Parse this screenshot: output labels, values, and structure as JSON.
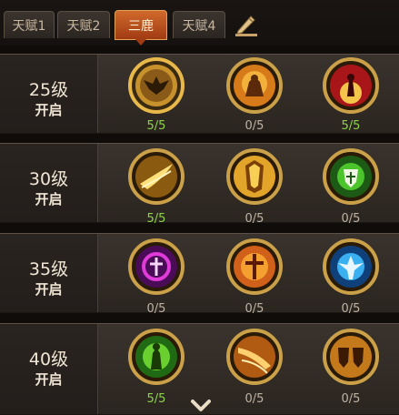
{
  "tabs": [
    {
      "label": "天赋1",
      "active": false
    },
    {
      "label": "天赋2",
      "active": false
    },
    {
      "label": "三鹿",
      "active": true
    },
    {
      "label": "天赋4",
      "active": false
    }
  ],
  "rows": [
    {
      "level": "25级",
      "state": "开启",
      "skills": [
        {
          "name": "winged-emblem-icon",
          "count": "5/5",
          "maxed": true,
          "selected": true
        },
        {
          "name": "warrior-flame-icon",
          "count": "0/5",
          "maxed": false
        },
        {
          "name": "red-figure-icon",
          "count": "5/5",
          "maxed": true
        }
      ]
    },
    {
      "level": "30级",
      "state": "开启",
      "skills": [
        {
          "name": "golden-slash-icon",
          "count": "5/5",
          "maxed": true
        },
        {
          "name": "golden-armor-icon",
          "count": "0/5",
          "maxed": false
        },
        {
          "name": "green-shield-icon",
          "count": "0/5",
          "maxed": false
        }
      ]
    },
    {
      "level": "35级",
      "state": "开启",
      "skills": [
        {
          "name": "purple-cross-icon",
          "count": "0/5",
          "maxed": false
        },
        {
          "name": "fire-cross-icon",
          "count": "0/5",
          "maxed": false
        },
        {
          "name": "blue-angel-icon",
          "count": "0/5",
          "maxed": false
        }
      ]
    },
    {
      "level": "40级",
      "state": "开启",
      "skills": [
        {
          "name": "green-monk-icon",
          "count": "5/5",
          "maxed": true
        },
        {
          "name": "orange-strike-icon",
          "count": "0/5",
          "maxed": false
        },
        {
          "name": "twin-shield-icon",
          "count": "0/5",
          "maxed": false
        }
      ]
    }
  ],
  "colors": {
    "maxed": "#8cd34a",
    "empty": "#bfb3a4",
    "accent": "#c85a22",
    "ring": "#d7a23c"
  }
}
